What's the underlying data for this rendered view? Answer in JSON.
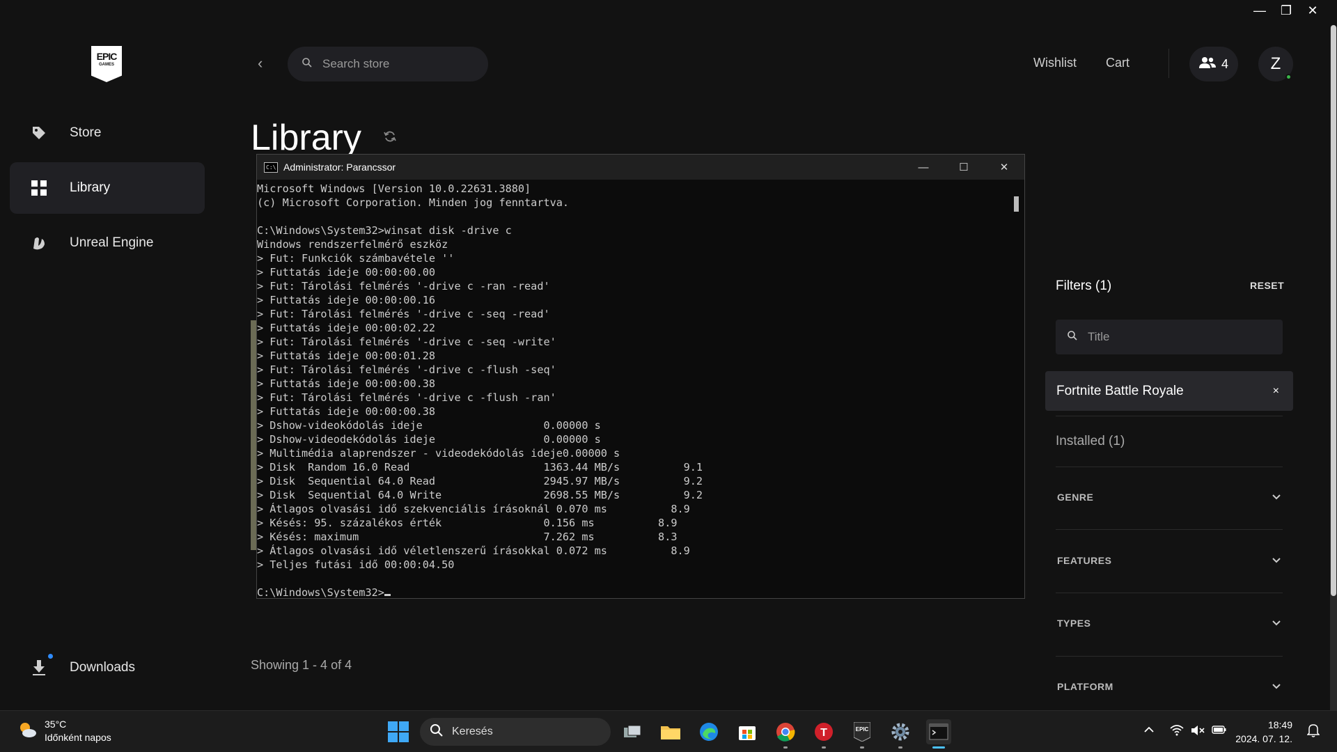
{
  "window_controls": {
    "minimize": "—",
    "restore": "❐",
    "close": "✕"
  },
  "logo": {
    "line1": "EPIC",
    "line2": "GAMES"
  },
  "sidebar": {
    "items": [
      {
        "label": "Store",
        "icon": "tag-icon"
      },
      {
        "label": "Library",
        "icon": "grid-icon"
      },
      {
        "label": "Unreal Engine",
        "icon": "unreal-icon"
      }
    ],
    "downloads_label": "Downloads"
  },
  "header": {
    "search_placeholder": "Search store",
    "wishlist": "Wishlist",
    "cart": "Cart",
    "friends_count": "4",
    "avatar_letter": "Z"
  },
  "main": {
    "title": "Library",
    "showing": "Showing 1 - 4 of 4"
  },
  "filters": {
    "title": "Filters (1)",
    "reset": "RESET",
    "title_placeholder": "Title",
    "active_chip": "Fortnite Battle Royale",
    "chip_close": "×",
    "installed": "Installed (1)",
    "sections": [
      "GENRE",
      "FEATURES",
      "TYPES",
      "PLATFORM"
    ]
  },
  "cmd": {
    "title": "Administrator: Parancssor",
    "lines": [
      "Microsoft Windows [Version 10.0.22631.3880]",
      "(c) Microsoft Corporation. Minden jog fenntartva.",
      "",
      "C:\\Windows\\System32>winsat disk -drive c",
      "Windows rendszerfelmérő eszköz",
      "> Fut: Funkciók számbavétele ''",
      "> Futtatás ideje 00:00:00.00",
      "> Fut: Tárolási felmérés '-drive c -ran -read'",
      "> Futtatás ideje 00:00:00.16",
      "> Fut: Tárolási felmérés '-drive c -seq -read'",
      "> Futtatás ideje 00:00:02.22",
      "> Fut: Tárolási felmérés '-drive c -seq -write'",
      "> Futtatás ideje 00:00:01.28",
      "> Fut: Tárolási felmérés '-drive c -flush -seq'",
      "> Futtatás ideje 00:00:00.38",
      "> Fut: Tárolási felmérés '-drive c -flush -ran'",
      "> Futtatás ideje 00:00:00.38",
      "> Dshow-videokódolás ideje                   0.00000 s",
      "> Dshow-videodekódolás ideje                 0.00000 s",
      "> Multimédia alaprendszer - videodekódolás ideje0.00000 s",
      "> Disk  Random 16.0 Read                     1363.44 MB/s          9.1",
      "> Disk  Sequential 64.0 Read                 2945.97 MB/s          9.2",
      "> Disk  Sequential 64.0 Write                2698.55 MB/s          9.2",
      "> Átlagos olvasási idő szekvenciális írásoknál 0.070 ms          8.9",
      "> Késés: 95. százalékos érték                0.156 ms          8.9",
      "> Késés: maximum                             7.262 ms          8.3",
      "> Átlagos olvasási idő véletlenszerű írásokkal 0.072 ms          8.9",
      "> Teljes futási idő 00:00:04.50",
      "",
      "C:\\Windows\\System32>"
    ]
  },
  "taskbar": {
    "weather_temp": "35°C",
    "weather_desc": "Időnként napos",
    "search": "Keresés",
    "time": "18:49",
    "date": "2024. 07. 12."
  }
}
